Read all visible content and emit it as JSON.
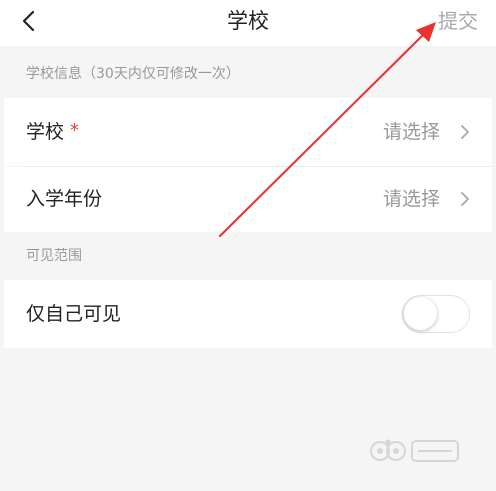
{
  "header": {
    "back_icon": "chevron-left-icon",
    "title": "学校",
    "submit_label": "提交"
  },
  "sections": {
    "school_info_label": "学校信息（30天内仅可修改一次）",
    "visibility_label": "可见范围"
  },
  "rows": {
    "school": {
      "label": "学校",
      "required_mark": "*",
      "value_placeholder": "请选择"
    },
    "enrollment_year": {
      "label": "入学年份",
      "value_placeholder": "请选择"
    },
    "only_me_visible": {
      "label": "仅自己可见",
      "toggle_on": false
    }
  },
  "colors": {
    "required": "#e0452b",
    "annotation_arrow": "#e8322b",
    "muted_text": "#999999"
  }
}
